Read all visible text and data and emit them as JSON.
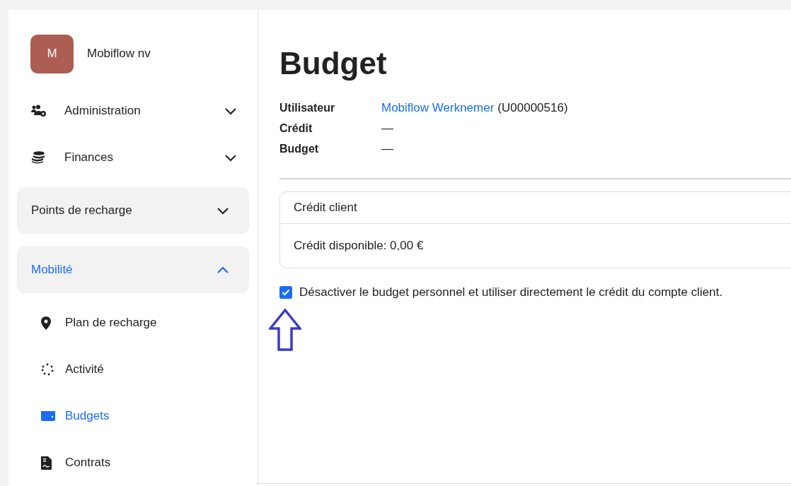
{
  "org": {
    "initial": "M",
    "name": "Mobiflow nv"
  },
  "nav": [
    {
      "kind": "menu",
      "label": "Administration",
      "expanded": false
    },
    {
      "kind": "menu",
      "label": "Finances",
      "expanded": false
    },
    {
      "kind": "group",
      "label": "Points de recharge",
      "expanded": false,
      "selected": false
    },
    {
      "kind": "group",
      "label": "Mobilité",
      "expanded": true,
      "selected": true
    },
    {
      "kind": "link",
      "label": "Plan de recharge",
      "selected": false
    },
    {
      "kind": "link",
      "label": "Activité",
      "selected": false
    },
    {
      "kind": "link",
      "label": "Budgets",
      "selected": true
    },
    {
      "kind": "link",
      "label": "Contrats",
      "selected": false
    }
  ],
  "title": "Budget",
  "details": [
    {
      "label": "Utilisateur",
      "link": "Mobiflow Werknemer",
      "value": "(U00000516)"
    },
    {
      "label": "Crédit",
      "value": "—"
    },
    {
      "label": "Budget",
      "value": "—"
    }
  ],
  "card": {
    "title": "Crédit client",
    "body": "Crédit disponible: 0,00 €"
  },
  "option": {
    "label": "Désactiver le budget personnel et utiliser directement le crédit du compte client.",
    "checked": true
  }
}
